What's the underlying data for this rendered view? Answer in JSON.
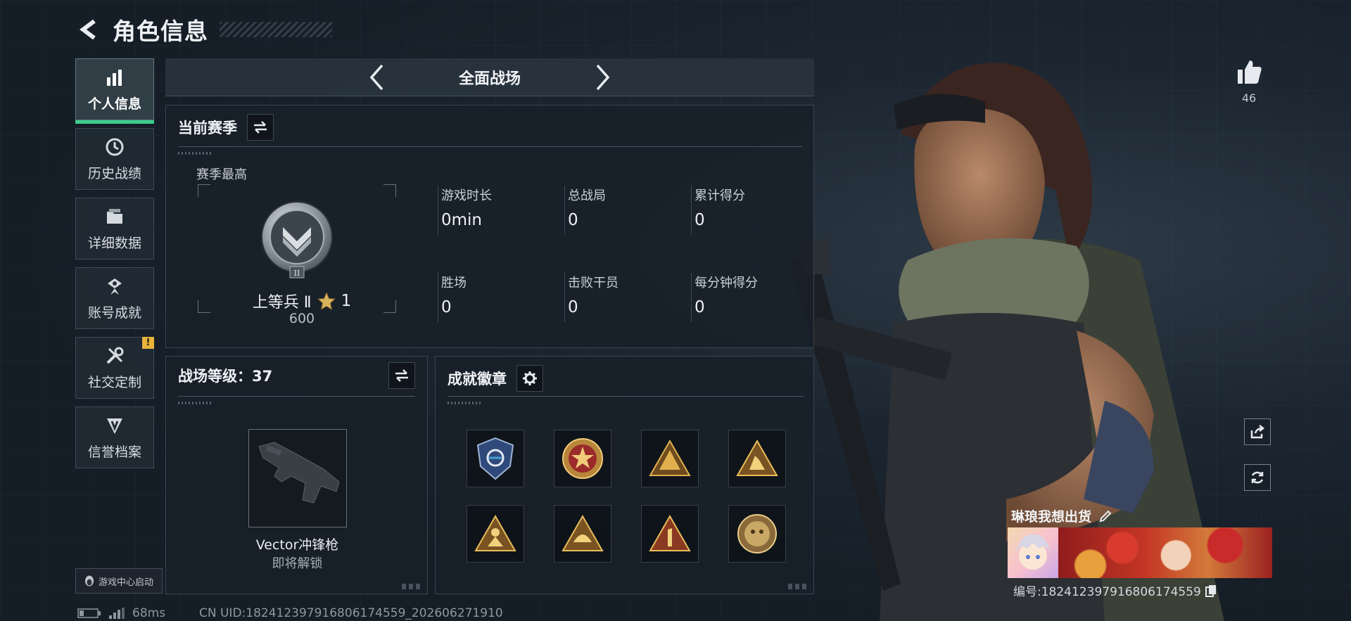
{
  "header": {
    "title": "角色信息"
  },
  "nav": {
    "items": [
      {
        "label": "个人信息",
        "icon": "bar-chart-icon",
        "active": true
      },
      {
        "label": "历史战绩",
        "icon": "clock-icon",
        "active": false
      },
      {
        "label": "详细数据",
        "icon": "folder-icon",
        "active": false
      },
      {
        "label": "账号成就",
        "icon": "achievement-icon",
        "active": false
      },
      {
        "label": "社交定制",
        "icon": "tools-icon",
        "active": false,
        "badge": "!"
      },
      {
        "label": "信誉档案",
        "icon": "shield-icon",
        "active": false
      }
    ],
    "game_center_label": "游戏中心启动"
  },
  "mode": {
    "label": "全面战场"
  },
  "season": {
    "title": "当前赛季",
    "best_label": "赛季最高",
    "rank_name": "上等兵 Ⅱ",
    "rank_tier": "II",
    "rank_stars": "1",
    "rank_score": "600",
    "stats": [
      {
        "label": "游戏时长",
        "value": "0min"
      },
      {
        "label": "总战局",
        "value": "0"
      },
      {
        "label": "累计得分",
        "value": "0"
      },
      {
        "label": "胜场",
        "value": "0"
      },
      {
        "label": "击败干员",
        "value": "0"
      },
      {
        "label": "每分钟得分",
        "value": "0"
      }
    ]
  },
  "level": {
    "title": "战场等级：37",
    "weapon_name": "Vector冲锋枪",
    "weapon_status": "即将解锁"
  },
  "badges": {
    "title": "成就徽章",
    "items": [
      "badge-1",
      "badge-2",
      "badge-3",
      "badge-4",
      "badge-5",
      "badge-6",
      "badge-7",
      "badge-8"
    ]
  },
  "profile": {
    "likes": "46",
    "player_name": "琳琅我想出货",
    "player_id": "编号:18241239791680617455​9"
  },
  "footer": {
    "ping": "68ms",
    "uid": "CN UID:182412397916806174559_202606271910"
  },
  "colors": {
    "accent": "#3ccc8c",
    "badge_gold": "#d6a24a",
    "warning": "#e8b43a"
  }
}
